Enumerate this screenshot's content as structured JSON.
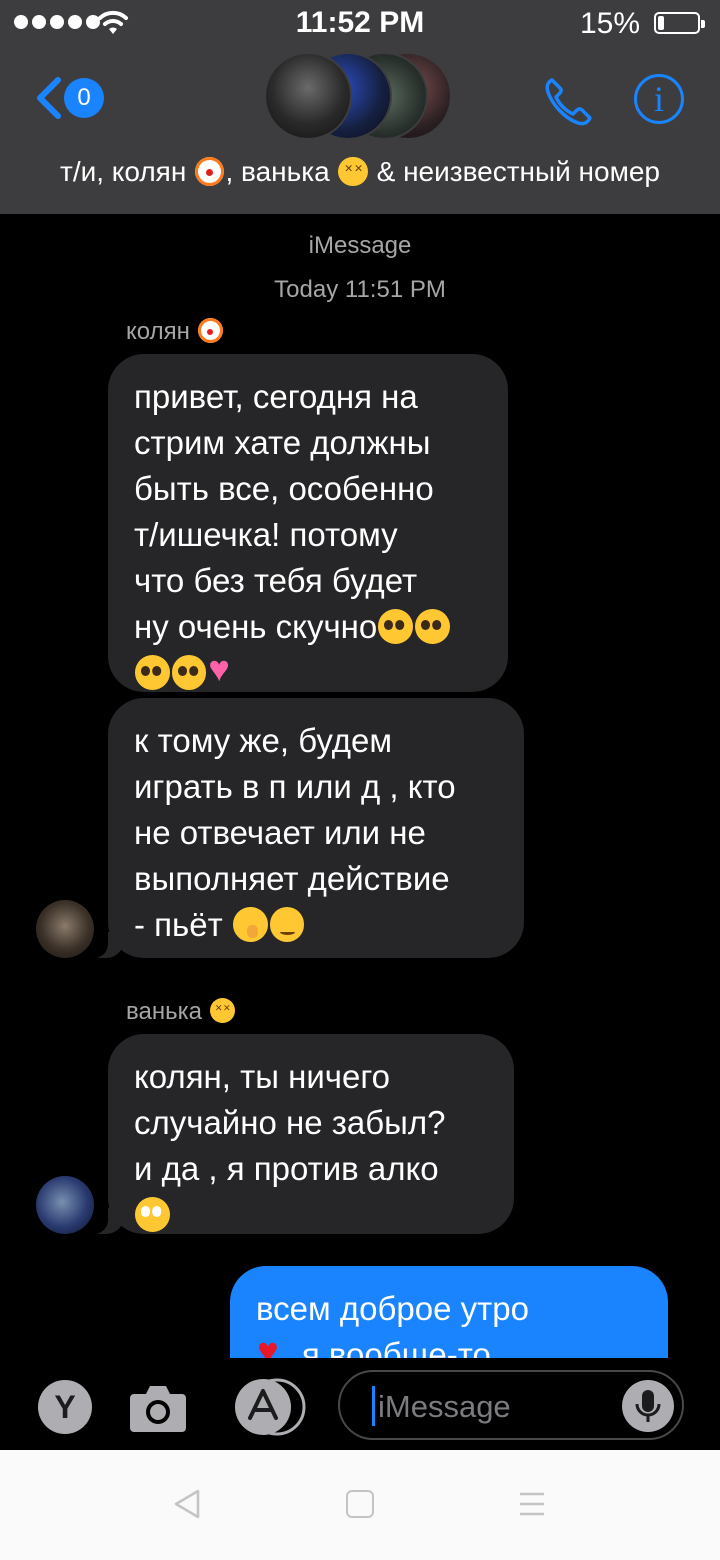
{
  "status_bar": {
    "time": "11:52 PM",
    "battery_percent": "15%",
    "battery_level": 0.15,
    "signal_dots": 5,
    "wifi_icon": "wifi-icon"
  },
  "header": {
    "back_badge": "0",
    "group_name": "т/и, колян , ванька  & неизвестный номер",
    "group_name_parts": [
      "т/и, колян",
      ", ванька",
      "& неизвестный номер"
    ],
    "icons": [
      "back-chevron-icon",
      "phone-icon",
      "info-icon"
    ]
  },
  "conversation": {
    "service": "iMessage",
    "timestamp": "Today 11:51 PM",
    "senders": {
      "kolyan": "колян",
      "vanka": "ванька"
    },
    "messages": [
      {
        "from": "колян",
        "text_lines": [
          "привет, сегодня на",
          "стрим хате должны",
          "быть все, особенно",
          "т/ишечка! потому",
          "что без тебя будет",
          "ну очень скучно"
        ]
      },
      {
        "from": "колян",
        "text_lines": [
          "к тому же, будем",
          "играть в п или д , кто",
          "не отвечает или не",
          "выполняет действие",
          "- пьёт"
        ]
      },
      {
        "from": "ванька",
        "text_lines": [
          "колян, ты ничего",
          "случайно не забыл?",
          "и да , я против алко"
        ]
      },
      {
        "from": "me",
        "text_lines": [
          "всем доброе утро",
          "я вообще-то"
        ]
      }
    ]
  },
  "input_bar": {
    "apps_letter": "Y",
    "placeholder": "iMessage",
    "icons": [
      "camera-icon",
      "app-store-icon",
      "microphone-icon"
    ]
  },
  "colors": {
    "header_bg": "#3d3d3f",
    "accent": "#1a84ff",
    "incoming_bubble": "#262628",
    "outgoing_bubble": "#1a84ff",
    "meta_text": "#a6a6a6"
  }
}
